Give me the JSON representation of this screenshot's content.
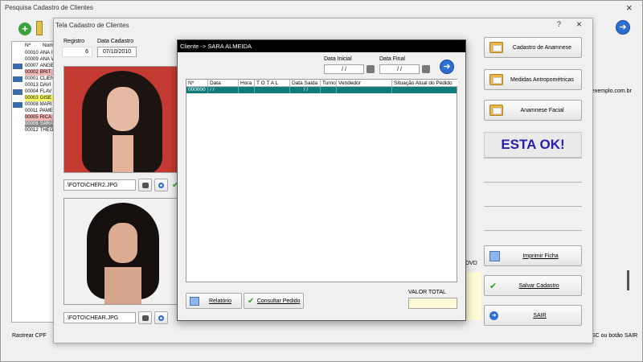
{
  "outer_window": {
    "title": "Pesquisa Cadastro de Clientes",
    "close": "×",
    "bottom_label": "Rastrear CPF",
    "bottom_right_text": "SC ou botão SAIR",
    "email_fragment": "exemplo.com.br"
  },
  "outer_grid": {
    "headers": [
      "Nº",
      "Nome"
    ],
    "rows": [
      {
        "num": "00010",
        "name": "ANA I"
      },
      {
        "num": "00009",
        "name": "ANA V"
      },
      {
        "num": "00007",
        "name": "ANGE"
      },
      {
        "num": "00002",
        "name": "BRIT"
      },
      {
        "num": "00001",
        "name": "CLIEN"
      },
      {
        "num": "00013",
        "name": "DAVI"
      },
      {
        "num": "00004",
        "name": "FLAV"
      },
      {
        "num": "00003",
        "name": "GISE"
      },
      {
        "num": "00008",
        "name": "MARI"
      },
      {
        "num": "00011",
        "name": "PAME"
      },
      {
        "num": "00005",
        "name": "RICA"
      },
      {
        "num": "00006",
        "name": "SARA"
      },
      {
        "num": "00012",
        "name": "THEO"
      }
    ]
  },
  "cadastro_window": {
    "title": "Tela Cadastro de Clientes",
    "help": "?",
    "close": "×",
    "registro_label": "Registro",
    "registro_value": "6",
    "data_cadastro_label": "Data Cadastro",
    "data_cadastro_value": "07/10/2010",
    "photo1_path": ".\\FOTO\\CHER2.JPG",
    "photo2_path": ".\\FOTO\\CHEAR.JPG",
    "dvd_fragment": "DVD",
    "buttons": {
      "anamnese": "Cadastro de Anamnese",
      "medidas": "Medidas Antropométricas",
      "facial": "Anamnese Facial",
      "status": "ESTA OK!",
      "imprimir": "Imprimir Ficha",
      "salvar": "Salvar Cadastro",
      "sair": "SAIR"
    }
  },
  "pedidos_dialog": {
    "title": "Cliente -> SARA ALMEIDA",
    "data_inicial_label": "Data Inicial",
    "data_inicial_value": " / /",
    "data_final_label": "Data Final",
    "data_final_value": " / /",
    "columns": [
      "Nº",
      "Data",
      "Hora",
      "T O T A L",
      "Data Saida",
      "Turno",
      "Vendedor",
      "Situação Atual do Pedido"
    ],
    "rows": [
      {
        "num": "000000",
        "data": " / /",
        "hora": "",
        "total": "",
        "saida": " / /",
        "turno": "",
        "vendedor": "",
        "situacao": ""
      }
    ],
    "relatorio_label": "Relatório",
    "consultar_label": "Consultar Pedido",
    "valor_total_label": "VALOR TOTAL",
    "valor_total_value": ""
  },
  "colors": {
    "selected_row": "#117b7b",
    "pink_row": "#f5b8b8",
    "yellow_row": "#ffff66",
    "status_text": "#2a1db0",
    "dialog_title_bg": "#000000"
  }
}
